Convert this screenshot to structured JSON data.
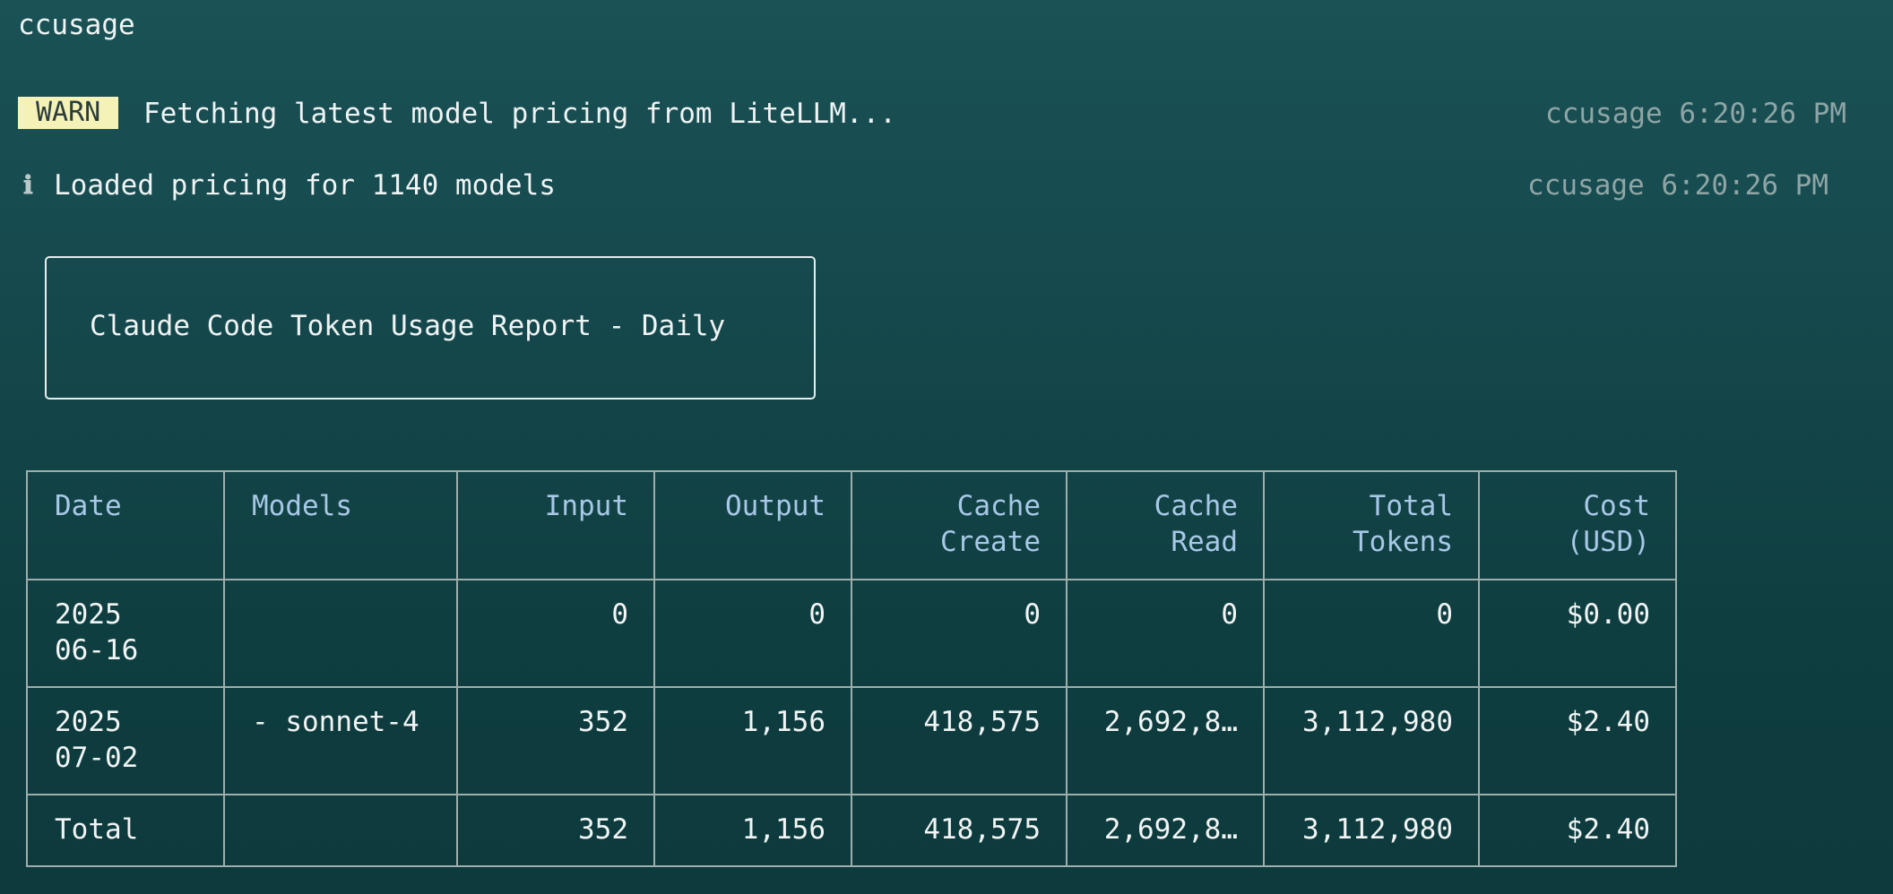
{
  "window": {
    "title": "ccusage"
  },
  "logs": [
    {
      "level_badge": "WARN",
      "message": "Fetching latest model pricing from LiteLLM...",
      "source_time": "ccusage 6:20:26 PM"
    },
    {
      "level_icon": "ℹ",
      "message": "Loaded pricing for 1140 models",
      "source_time": "ccusage 6:20:26 PM"
    }
  ],
  "report": {
    "title": "Claude Code Token Usage Report - Daily"
  },
  "table": {
    "headers": [
      {
        "l1": "Date",
        "l2": ""
      },
      {
        "l1": "Models",
        "l2": ""
      },
      {
        "l1": "Input",
        "l2": ""
      },
      {
        "l1": "Output",
        "l2": ""
      },
      {
        "l1": "Cache",
        "l2": "Create"
      },
      {
        "l1": "Cache",
        "l2": "Read"
      },
      {
        "l1": "Total",
        "l2": "Tokens"
      },
      {
        "l1": "Cost",
        "l2": "(USD)"
      }
    ],
    "rows": [
      {
        "date_l1": "2025",
        "date_l2": "06-16",
        "models": "",
        "input": "0",
        "output": "0",
        "cache_create": "0",
        "cache_read": "0",
        "total_tokens": "0",
        "cost": "$0.00"
      },
      {
        "date_l1": "2025",
        "date_l2": "07-02",
        "models": "- sonnet-4",
        "input": "352",
        "output": "1,156",
        "cache_create": "418,575",
        "cache_read": "2,692,8…",
        "total_tokens": "3,112,980",
        "cost": "$2.40"
      }
    ],
    "total": {
      "label": "Total",
      "models": "",
      "input": "352",
      "output": "1,156",
      "cache_create": "418,575",
      "cache_read": "2,692,8…",
      "total_tokens": "3,112,980",
      "cost": "$2.40"
    }
  },
  "colors": {
    "background_top": "#1a5256",
    "background_bottom": "#0d3a3c",
    "header_text": "#a7c8e6",
    "total_text": "#f4f2b6",
    "warn_badge_bg": "#f4f2b6",
    "muted_text": "#8fa5a5",
    "table_border": "#9faeac"
  }
}
